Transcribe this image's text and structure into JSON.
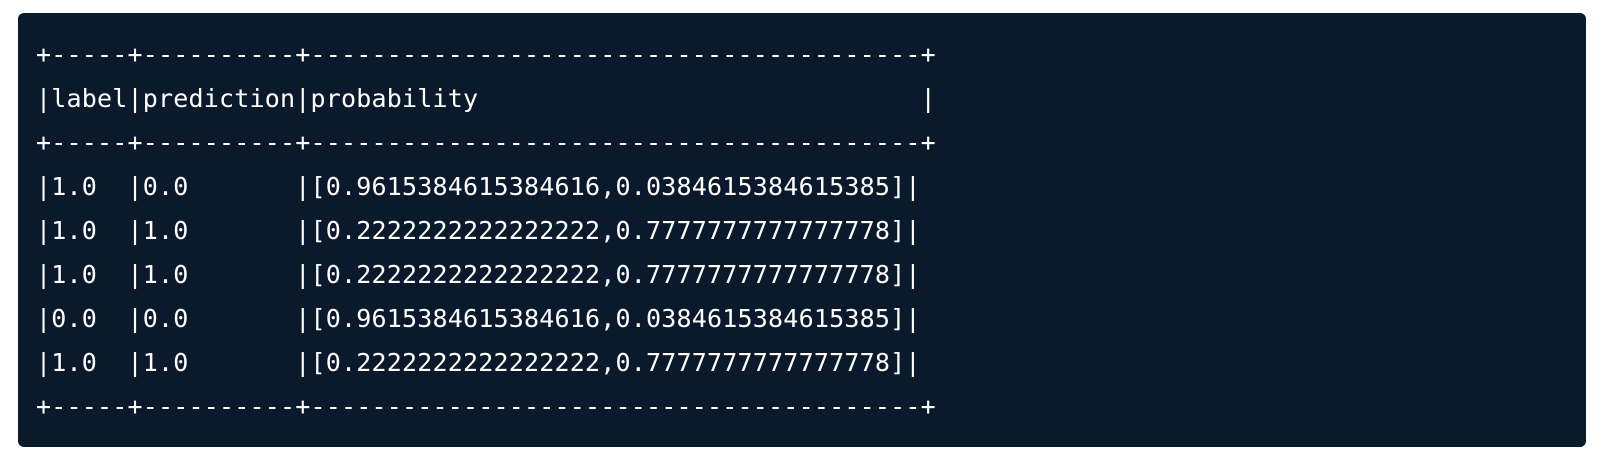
{
  "code_block": {
    "lines": [
      "+-----+----------+----------------------------------------+",
      "|label|prediction|probability                             |",
      "+-----+----------+----------------------------------------+",
      "|1.0  |0.0       |[0.9615384615384616,0.0384615384615385]|",
      "|1.0  |1.0       |[0.2222222222222222,0.7777777777777778]|",
      "|1.0  |1.0       |[0.2222222222222222,0.7777777777777778]|",
      "|0.0  |0.0       |[0.9615384615384616,0.0384615384615385]|",
      "|1.0  |1.0       |[0.2222222222222222,0.7777777777777778]|",
      "+-----+----------+----------------------------------------+"
    ]
  },
  "colors": {
    "background": "#0b192c",
    "text": "#ffffff"
  }
}
